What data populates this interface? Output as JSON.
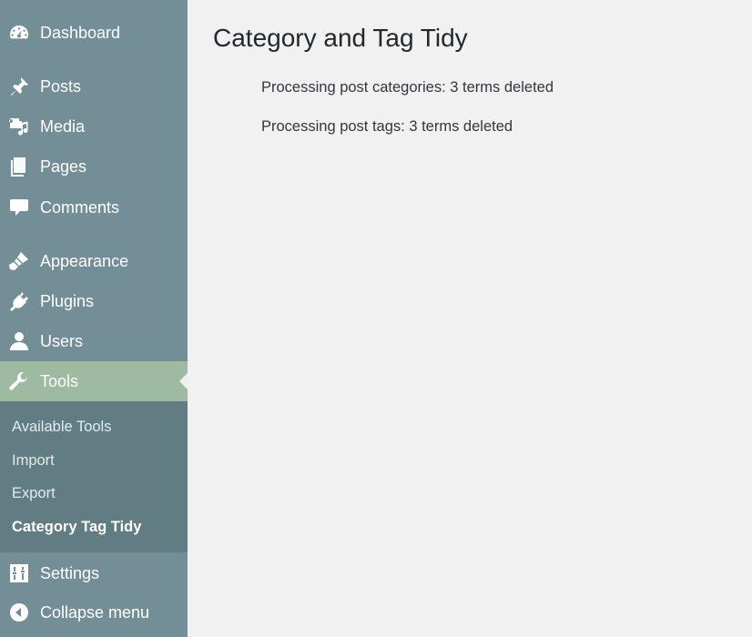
{
  "sidebar": {
    "menu": [
      {
        "label": "Dashboard",
        "icon": "dashboard-icon"
      },
      {
        "label": "Posts",
        "icon": "pushpin-icon"
      },
      {
        "label": "Media",
        "icon": "media-icon"
      },
      {
        "label": "Pages",
        "icon": "pages-icon"
      },
      {
        "label": "Comments",
        "icon": "comment-bubble-icon"
      },
      {
        "label": "Appearance",
        "icon": "paintbrush-icon"
      },
      {
        "label": "Plugins",
        "icon": "plug-icon"
      },
      {
        "label": "Users",
        "icon": "user-icon"
      },
      {
        "label": "Tools",
        "icon": "wrench-icon",
        "active": true
      },
      {
        "label": "Settings",
        "icon": "sliders-icon"
      },
      {
        "label": "Collapse menu",
        "icon": "collapse-arrow-icon"
      }
    ],
    "tools_submenu": [
      {
        "label": "Available Tools"
      },
      {
        "label": "Import"
      },
      {
        "label": "Export"
      },
      {
        "label": "Category Tag Tidy",
        "current": true
      }
    ]
  },
  "main": {
    "title": "Category and Tag Tidy",
    "messages": [
      "Processing post categories: 3 terms deleted",
      "Processing post tags: 3 terms deleted"
    ]
  },
  "colors": {
    "sidebar_bg": "#738e96",
    "submenu_bg": "#627c83",
    "active_item_bg": "#9ebaa0",
    "page_bg": "#f1f1f1",
    "title_text": "#23282d"
  }
}
